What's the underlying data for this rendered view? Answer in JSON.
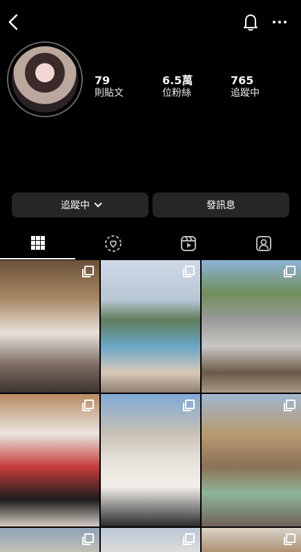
{
  "profile": {
    "posts_count": "79",
    "posts_label": "則貼文",
    "followers_count": "6.5萬",
    "followers_label": "位粉絲",
    "following_count": "765",
    "following_label": "追蹤中"
  },
  "actions": {
    "following_button": "追蹤中",
    "message_button": "發訊息"
  },
  "tabs": [
    {
      "name": "posts",
      "icon": "grid-icon"
    },
    {
      "name": "collabs",
      "icon": "collab-icon"
    },
    {
      "name": "reels",
      "icon": "reels-icon"
    },
    {
      "name": "tagged",
      "icon": "tagged-icon"
    }
  ],
  "colors": {
    "background": "#000000",
    "button_bg": "#262626",
    "text": "#f5f5f5"
  }
}
